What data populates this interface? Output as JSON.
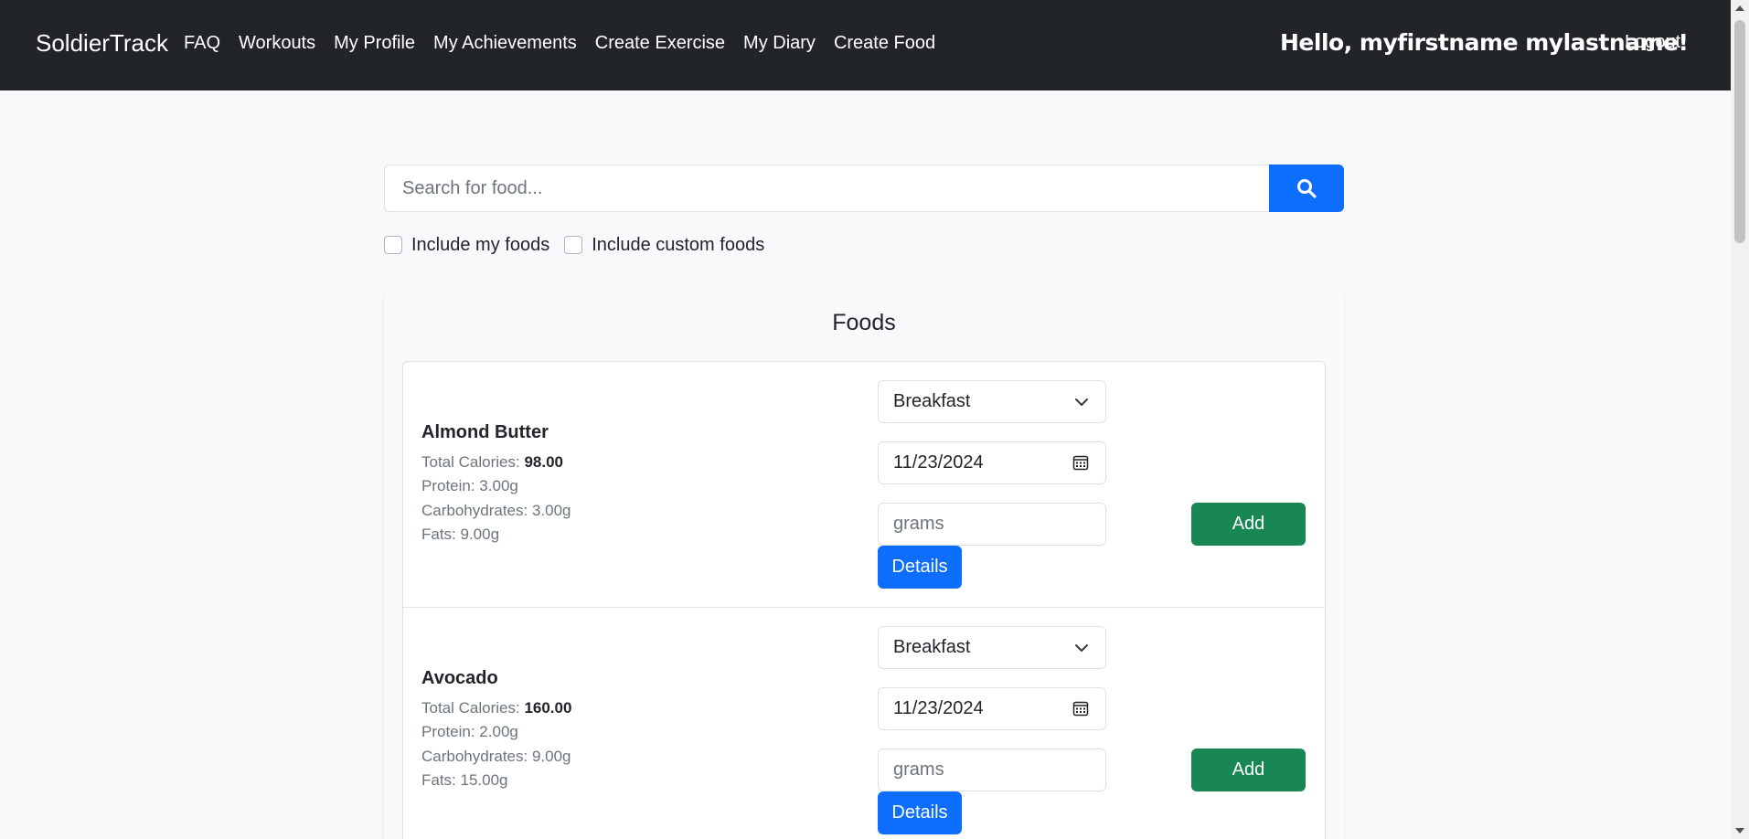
{
  "navbar": {
    "brand": "SoldierTrack",
    "links": [
      "FAQ",
      "Workouts",
      "My Profile",
      "My Achievements",
      "Create Exercise",
      "My Diary",
      "Create Food"
    ],
    "greeting": "Hello, myfirstname mylastname!",
    "logout": "Logout"
  },
  "search": {
    "placeholder": "Search for food...",
    "value": "",
    "button_icon": "search-icon"
  },
  "filters": {
    "include_my_foods": {
      "label": "Include my foods",
      "checked": false
    },
    "include_custom_foods": {
      "label": "Include custom foods",
      "checked": false
    }
  },
  "foods": {
    "title": "Foods",
    "items": [
      {
        "name": "Almond Butter",
        "calories_label": "Total Calories: ",
        "calories": "98.00",
        "protein": "Protein: 3.00g",
        "carbs": "Carbohydrates: 3.00g",
        "fats": "Fats: 9.00g",
        "meal": "Breakfast",
        "date": "11/23/2024",
        "grams_placeholder": "grams",
        "details_label": "Details",
        "add_label": "Add"
      },
      {
        "name": "Avocado",
        "calories_label": "Total Calories: ",
        "calories": "160.00",
        "protein": "Protein: 2.00g",
        "carbs": "Carbohydrates: 9.00g",
        "fats": "Fats: 15.00g",
        "meal": "Breakfast",
        "date": "11/23/2024",
        "grams_placeholder": "grams",
        "details_label": "Details",
        "add_label": "Add"
      }
    ]
  },
  "colors": {
    "navbar": "#212529",
    "primary": "#0d6efd",
    "success": "#198754",
    "background": "#f8f9fa"
  }
}
